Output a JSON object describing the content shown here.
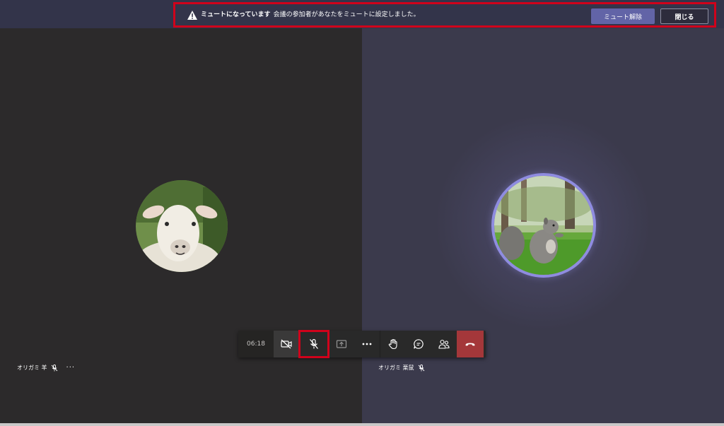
{
  "banner": {
    "title": "ミュートになっています",
    "message": "会議の参加者があなたをミュートに設定しました。",
    "unmute_label": "ミュート解除",
    "close_label": "閉じる",
    "icon": "warning-icon",
    "accent_color": "#d0021b"
  },
  "participants": [
    {
      "name": "オリガミ 羊",
      "avatar": "sheep-photo",
      "muted": true,
      "more_label": "···"
    },
    {
      "name": "オリガミ 栗鼠",
      "avatar": "squirrel-photo",
      "muted": true,
      "active_speaker_ring_color": "#8f8ce0"
    }
  ],
  "toolbar": {
    "timer": "06:18",
    "buttons": [
      {
        "name": "camera-off",
        "icon": "camera-off-icon"
      },
      {
        "name": "microphone-off",
        "icon": "mic-off-icon"
      },
      {
        "name": "share-screen",
        "icon": "share-icon"
      },
      {
        "name": "more-actions",
        "icon": "ellipsis-icon"
      },
      {
        "name": "raise-hand",
        "icon": "hand-icon"
      },
      {
        "name": "chat",
        "icon": "chat-icon"
      },
      {
        "name": "participants",
        "icon": "people-icon"
      },
      {
        "name": "hang-up",
        "icon": "phone-hangup-icon",
        "color": "#a4373a"
      }
    ]
  },
  "theme": {
    "brand": "#6264a7",
    "left_tile_bg": "#2c2a2b",
    "right_tile_bg": "#3b3a4c"
  }
}
